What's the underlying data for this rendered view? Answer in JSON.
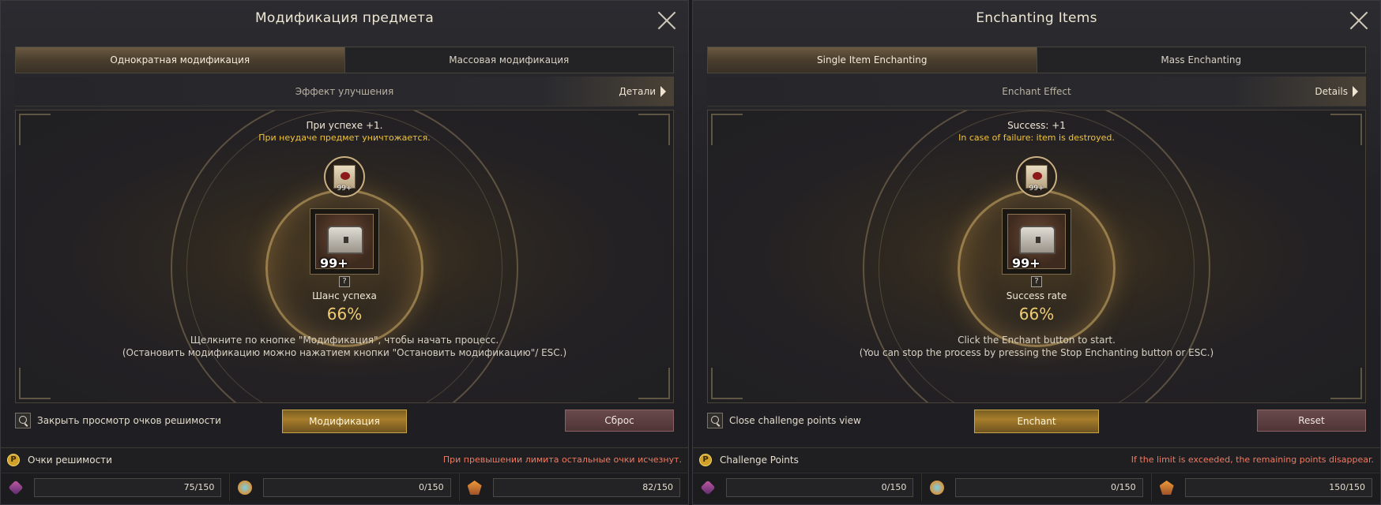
{
  "panels": [
    {
      "title": "Модификация предмета",
      "tabs": [
        "Однократная модификация",
        "Массовая модификация"
      ],
      "effect_label": "Эффект улучшения",
      "details_label": "Детали",
      "success_text": "При успехе +1.",
      "failure_text": "При неудаче предмет уничтожается.",
      "scroll_count": "99+",
      "item_count": "99+",
      "rate_label": "Шанс успеха",
      "rate_value": "66%",
      "hint1": "Щелкните по кнопке \"Модификация\", чтобы начать процесс.",
      "hint2": "(Остановить модификацию можно нажатием кнопки \"Остановить модификацию\"/ ESC.)",
      "toggle_label": "Закрыть просмотр очков решимости",
      "main_button": "Модификация",
      "reset_button": "Сброс",
      "cp_label": "Очки решимости",
      "cp_icon": "P",
      "cp_warning": "При превышении лимита остальные очки исчезнут.",
      "points": [
        "75/150",
        "0/150",
        "82/150"
      ]
    },
    {
      "title": "Enchanting Items",
      "tabs": [
        "Single Item Enchanting",
        "Mass Enchanting"
      ],
      "effect_label": "Enchant Effect",
      "details_label": "Details",
      "success_text": "Success: +1",
      "failure_text": "In case of failure: item is destroyed.",
      "scroll_count": "99+",
      "item_count": "99+",
      "rate_label": "Success rate",
      "rate_value": "66%",
      "hint1": "Click the Enchant button to start.",
      "hint2": "(You can stop the process by pressing the Stop Enchanting button or ESC.)",
      "toggle_label": "Close challenge points view",
      "main_button": "Enchant",
      "reset_button": "Reset",
      "cp_label": "Challenge Points",
      "cp_icon": "P",
      "cp_warning": "If the limit is exceeded, the remaining points disappear.",
      "points": [
        "0/150",
        "0/150",
        "150/150"
      ]
    }
  ],
  "icons": {
    "close": "close-icon",
    "details": "chevron-right-icon",
    "toggle": "magnifier-icon",
    "points": [
      "pink-crystal-icon",
      "rainbow-orb-icon",
      "orange-emblem-icon"
    ]
  },
  "colors": {
    "accent_gold": "#c9a646",
    "failure_yellow": "#f0c33a",
    "rate_gold": "#f0cc72",
    "warning_red": "#f07a62",
    "reset_red": "#6a4a4c"
  }
}
